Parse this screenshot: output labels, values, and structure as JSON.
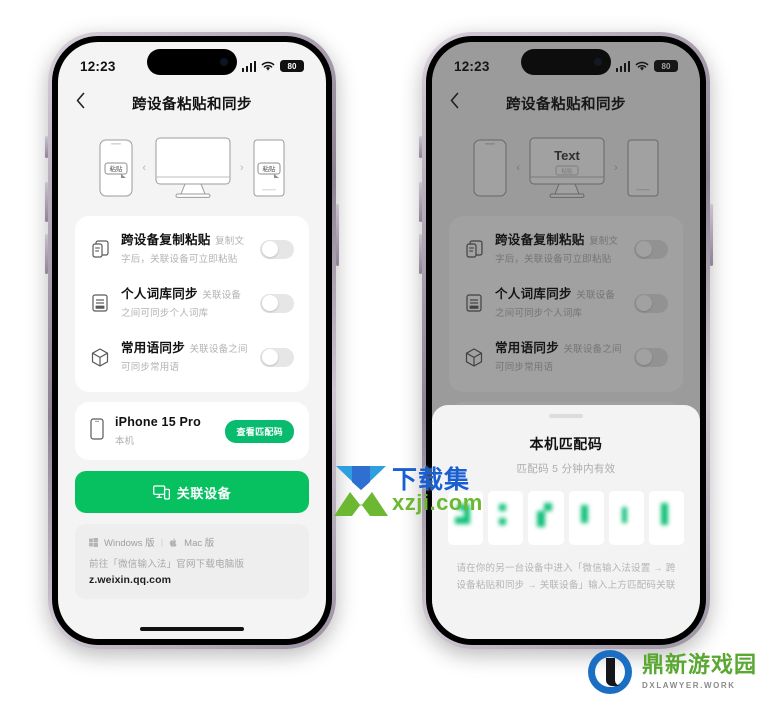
{
  "statusbar": {
    "time": "12:23",
    "battery": "80"
  },
  "nav": {
    "title": "跨设备粘贴和同步",
    "back_icon": "chevron-left-icon"
  },
  "hero": {
    "paste_label": "粘贴",
    "monitor_text_left": "",
    "monitor_text_right": "Text",
    "monitor_sub_right": "粘贴"
  },
  "settings": [
    {
      "icon": "copy-paste-icon",
      "title": "跨设备复制粘贴",
      "sub": "复制文字后，关联设备可立即粘贴",
      "on": false
    },
    {
      "icon": "dictionary-icon",
      "title": "个人词库同步",
      "sub": "关联设备之间可同步个人词库",
      "on": false
    },
    {
      "icon": "cube-icon",
      "title": "常用语同步",
      "sub": "关联设备之间可同步常用语",
      "on": false
    }
  ],
  "device": {
    "icon": "phone-icon",
    "name": "iPhone 15 Pro",
    "local": "本机",
    "badge": "查看匹配码"
  },
  "primary_button": {
    "icon": "link-devices-icon",
    "label": "关联设备"
  },
  "footer": {
    "windows": "Windows 版",
    "separator": "|",
    "mac": "Mac 版",
    "line": "前往「微信输入法」官网下载电脑版",
    "url": "z.weixin.qq.com"
  },
  "sheet": {
    "title": "本机匹配码",
    "subtitle": "匹配码 5 分钟内有效",
    "hint": "请在你的另一台设备中进入「微信输入法设置 → 跨设备粘贴和同步 → 关联设备」输入上方匹配码关联",
    "code_cells": 6
  },
  "watermarks": {
    "center_line1": "下载集",
    "center_line2": "xzji.com",
    "bottom_right_line1": "鼎新游戏园",
    "bottom_right_line2": "DXLAWYER.WORK"
  },
  "colors": {
    "brand_green": "#07c160",
    "badge_green": "#09bb6f",
    "code_green": "#12c07a",
    "screen_bg": "#f4f4f4",
    "card_bg": "#ffffff"
  }
}
